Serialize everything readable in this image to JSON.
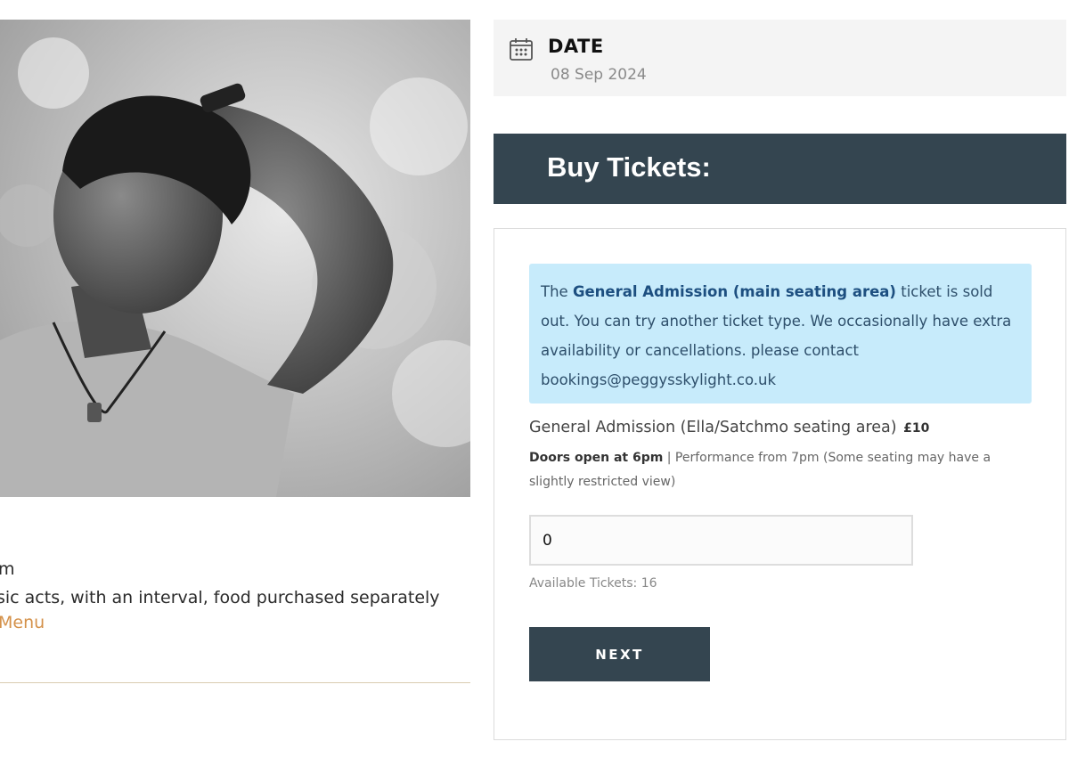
{
  "event": {
    "photo_alt": "Portrait of performer",
    "detail_line_1": "m",
    "detail_line_2": "sic acts, with an interval, food purchased separately",
    "menu_link": "Menu"
  },
  "date": {
    "label": "DATE",
    "value": "08 Sep 2024",
    "icon": "calendar-icon"
  },
  "buy": {
    "title": "Buy Tickets:"
  },
  "alert": {
    "prefix": "The ",
    "ticket_name": "General Admission (main seating area)",
    "suffix": " ticket is sold out. You can try another ticket type. We occasionally have extra availability or cancellations. please contact bookings@peggysskylight.co.uk"
  },
  "ticket": {
    "name": "General Admission (Ella/Satchmo seating area)",
    "price": "£10",
    "doors": "Doors open at 6pm",
    "description": " | Performance from 7pm (Some seating may have a slightly restricted view)",
    "quantity": "0",
    "available": "Available Tickets: 16"
  },
  "actions": {
    "next_label": "NEXT"
  },
  "colors": {
    "bar": "#344550",
    "alert_bg": "#c7ebfb",
    "link": "#d4914a"
  }
}
